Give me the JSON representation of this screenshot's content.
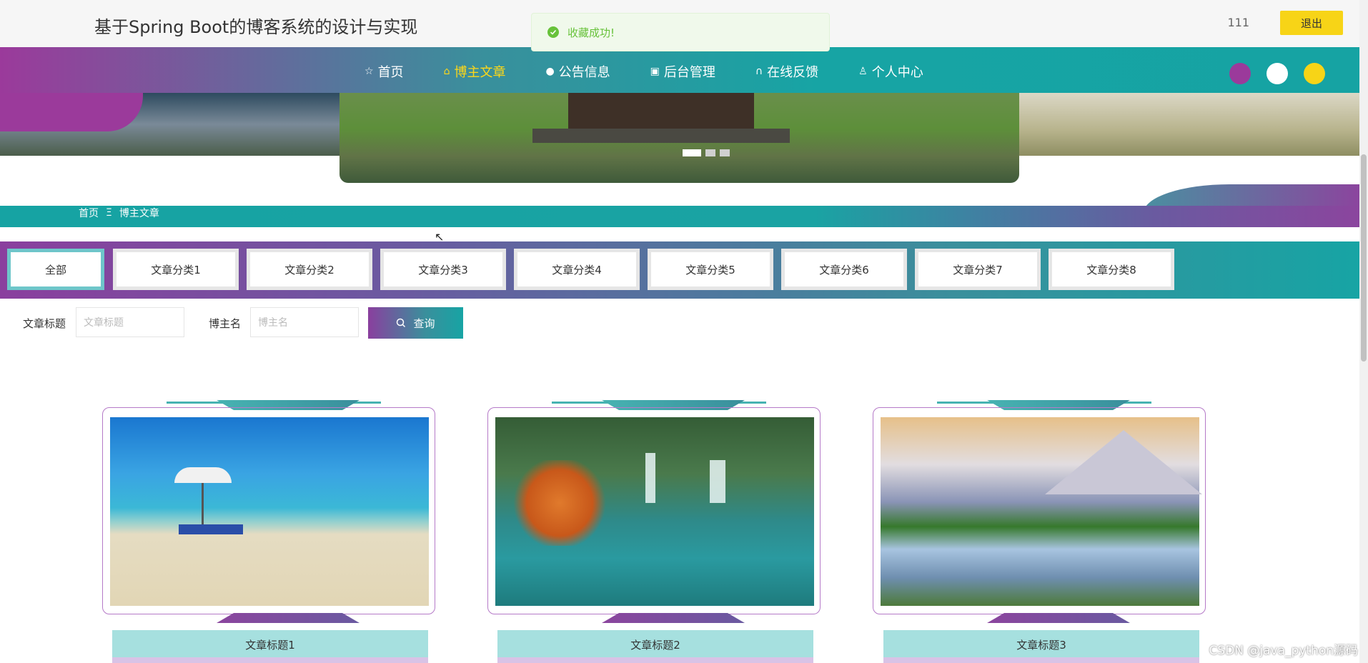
{
  "header": {
    "site_title": "基于Spring Boot的博客系统的设计与实现",
    "username": "111",
    "logout_label": "退出"
  },
  "toast": {
    "message": "收藏成功!"
  },
  "nav": {
    "items": [
      {
        "label": "首页",
        "icon": "star-icon"
      },
      {
        "label": "博主文章",
        "icon": "bag-icon",
        "active": true
      },
      {
        "label": "公告信息",
        "icon": "info-icon"
      },
      {
        "label": "后台管理",
        "icon": "box-icon"
      },
      {
        "label": "在线反馈",
        "icon": "headset-icon"
      },
      {
        "label": "个人中心",
        "icon": "user-icon"
      }
    ],
    "theme_dots": [
      "#9b3a9b",
      "#ffffff",
      "#f7d417"
    ]
  },
  "banner": {
    "slide_count": 3,
    "active_slide": 1
  },
  "breadcrumb": {
    "home": "首页",
    "separator": "Ξ",
    "current": "博主文章"
  },
  "categories": [
    {
      "label": "全部",
      "active": true
    },
    {
      "label": "文章分类1"
    },
    {
      "label": "文章分类2"
    },
    {
      "label": "文章分类3"
    },
    {
      "label": "文章分类4"
    },
    {
      "label": "文章分类5"
    },
    {
      "label": "文章分类6"
    },
    {
      "label": "文章分类7"
    },
    {
      "label": "文章分类8"
    }
  ],
  "search": {
    "title_label": "文章标题",
    "title_placeholder": "文章标题",
    "blogger_label": "博主名",
    "blogger_placeholder": "博主名",
    "query_label": "查询"
  },
  "articles": [
    {
      "title": "文章标题1",
      "image": "beach-umbrella"
    },
    {
      "title": "文章标题2",
      "image": "waterfall-autumn"
    },
    {
      "title": "文章标题3",
      "image": "mountain-lake"
    }
  ],
  "watermark": "CSDN @java_python源码",
  "colors": {
    "accent_yellow": "#f7d417",
    "purple": "#9b3a9b",
    "teal": "#17a4a4",
    "success": "#67c23a"
  }
}
